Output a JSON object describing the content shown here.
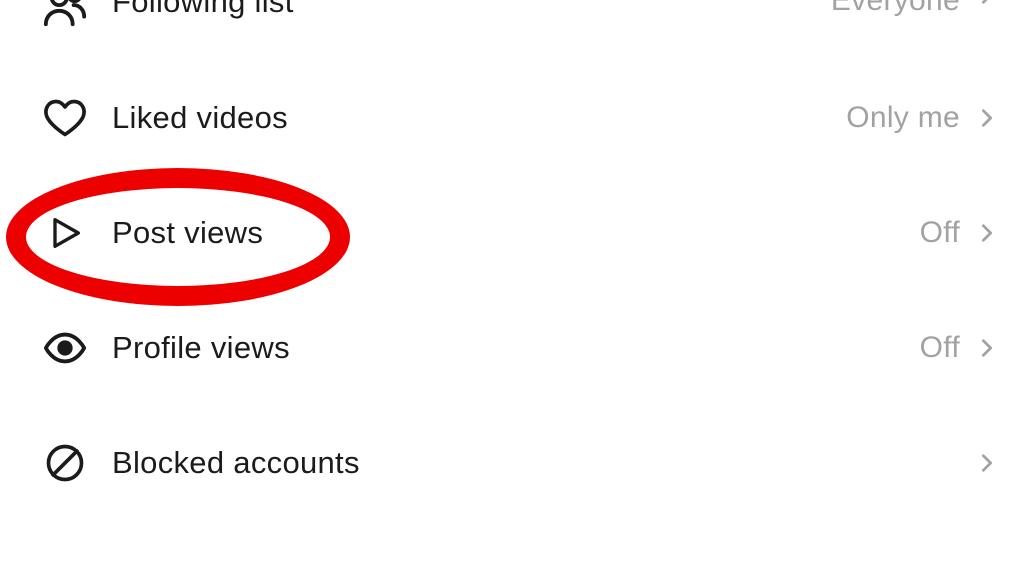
{
  "rows": [
    {
      "icon": "people",
      "label": "Following list",
      "value": "Everyone"
    },
    {
      "icon": "heart",
      "label": "Liked videos",
      "value": "Only me"
    },
    {
      "icon": "play",
      "label": "Post views",
      "value": "Off"
    },
    {
      "icon": "eye",
      "label": "Profile views",
      "value": "Off"
    },
    {
      "icon": "blocked",
      "label": "Blocked accounts",
      "value": ""
    }
  ],
  "highlight_index": 2
}
